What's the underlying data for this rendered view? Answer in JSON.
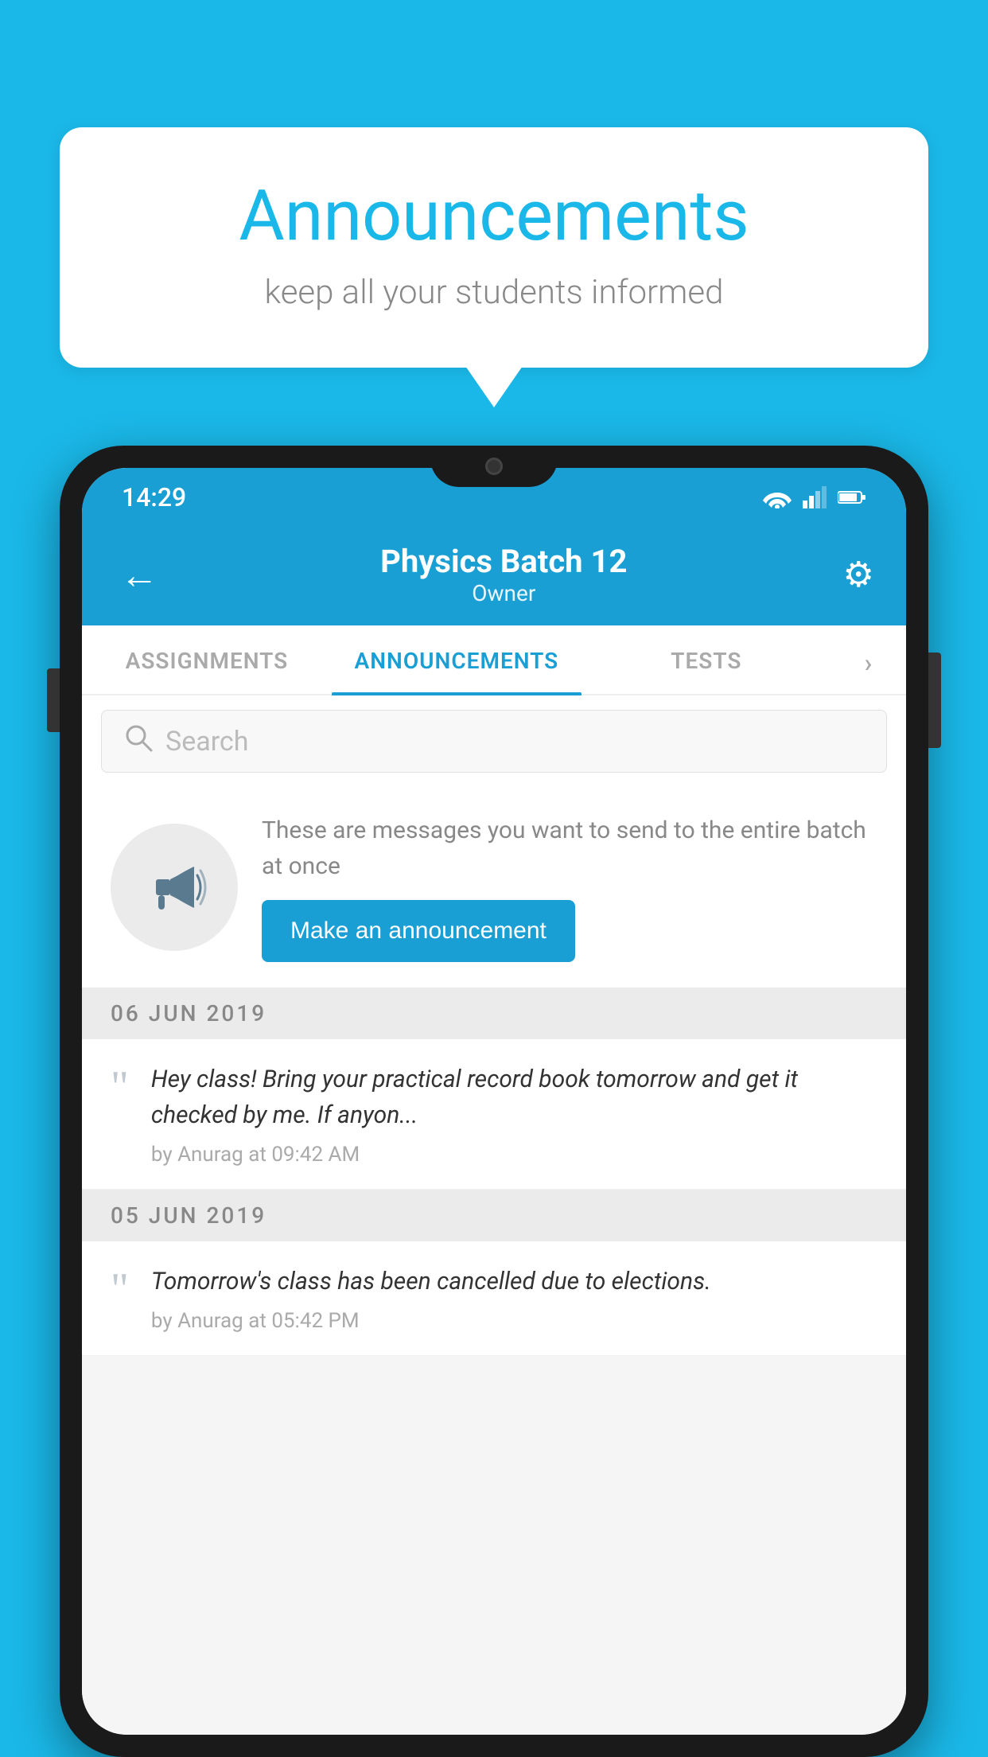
{
  "background_color": "#1ab8e8",
  "speech_bubble": {
    "title": "Announcements",
    "subtitle": "keep all your students informed"
  },
  "phone": {
    "status_bar": {
      "time": "14:29"
    },
    "header": {
      "title": "Physics Batch 12",
      "subtitle": "Owner",
      "back_label": "←",
      "gear_label": "⚙"
    },
    "tabs": [
      {
        "label": "ASSIGNMENTS",
        "active": false
      },
      {
        "label": "ANNOUNCEMENTS",
        "active": true
      },
      {
        "label": "TESTS",
        "active": false
      }
    ],
    "search": {
      "placeholder": "Search"
    },
    "promo_card": {
      "description": "These are messages you want to send to the entire batch at once",
      "button_label": "Make an announcement"
    },
    "date_sections": [
      {
        "date": "06  JUN  2019",
        "announcements": [
          {
            "text": "Hey class! Bring your practical record book tomorrow and get it checked by me. If anyon...",
            "meta": "by Anurag at 09:42 AM"
          }
        ]
      },
      {
        "date": "05  JUN  2019",
        "announcements": [
          {
            "text": "Tomorrow's class has been cancelled due to elections.",
            "meta": "by Anurag at 05:42 PM"
          }
        ]
      }
    ]
  }
}
